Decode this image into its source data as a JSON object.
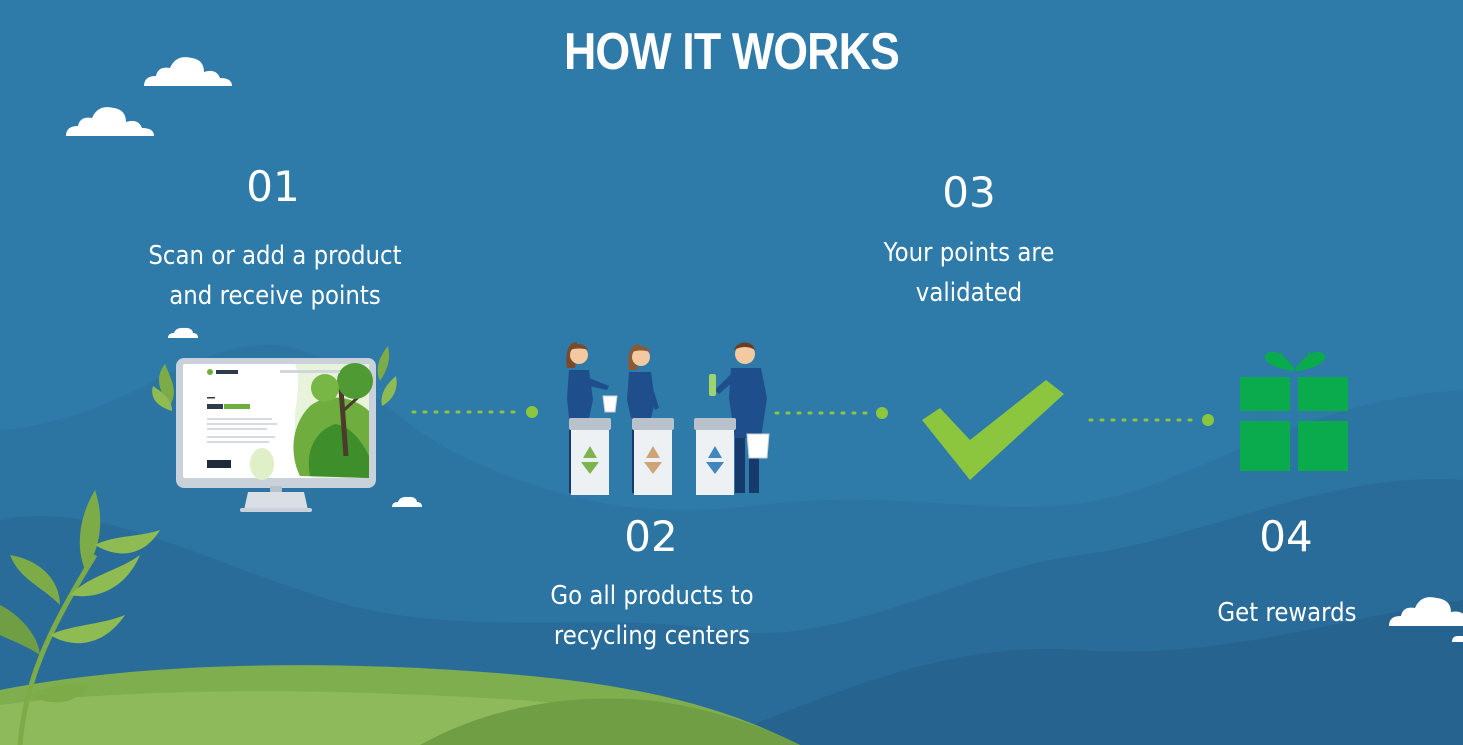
{
  "title": "HOW IT WORKS",
  "steps": [
    {
      "number": "01",
      "line1": "Scan or add a product",
      "line2": "and receive points"
    },
    {
      "number": "02",
      "line1": "Go all products to",
      "line2": "recycling centers"
    },
    {
      "number": "03",
      "line1": "Your points are",
      "line2": "validated"
    },
    {
      "number": "04",
      "line1": "Get rewards",
      "line2": ""
    }
  ],
  "monitor": {
    "brand": "Live Green",
    "greeting": "Hello, ",
    "name": "Alexandra!"
  },
  "colors": {
    "background": "#2e7aa9",
    "accent_green": "#8cc63f",
    "gift_green": "#0aab4d",
    "hill_green": "#8fba5c"
  },
  "icons": [
    "computer-monitor-icon",
    "recycling-bins-icon",
    "checkmark-icon",
    "gift-box-icon",
    "cloud-icon",
    "plant-icon"
  ]
}
